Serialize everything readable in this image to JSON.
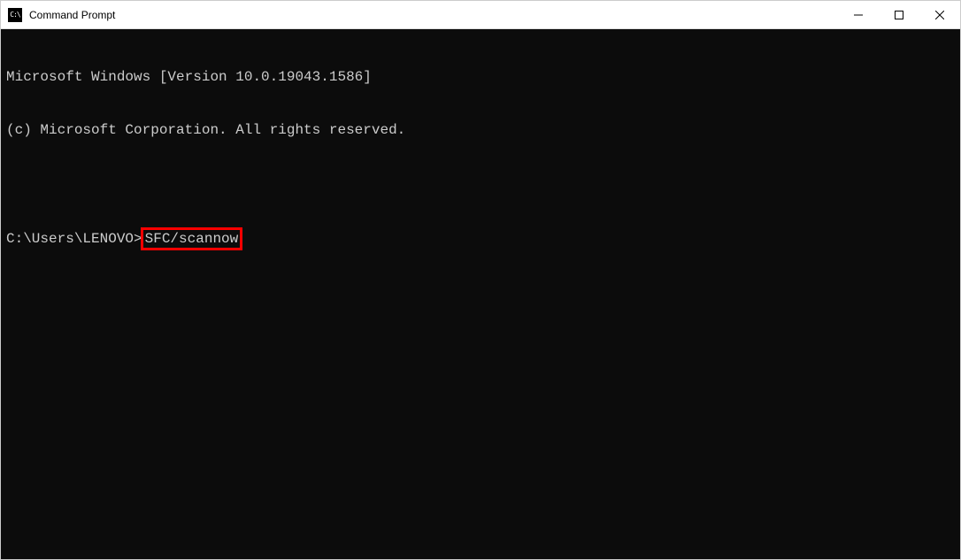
{
  "window": {
    "title": "Command Prompt",
    "icon_label": "C:\\"
  },
  "terminal": {
    "line1": "Microsoft Windows [Version 10.0.19043.1586]",
    "line2": "(c) Microsoft Corporation. All rights reserved.",
    "prompt": "C:\\Users\\LENOVO>",
    "command": "SFC/scannow"
  }
}
